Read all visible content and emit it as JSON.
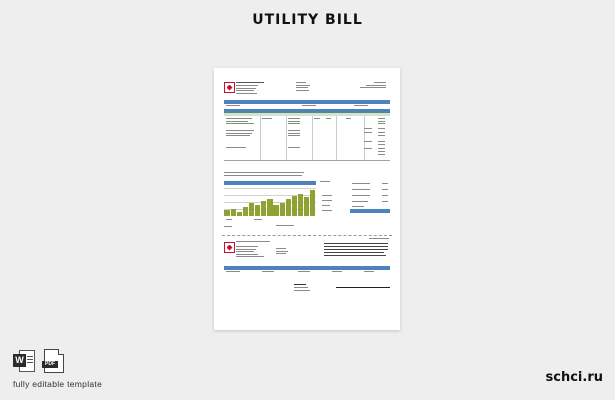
{
  "header": {
    "title": "UTILITY BILL"
  },
  "footer": {
    "template_note": "fully editable template",
    "site": "schci.ru",
    "word_icon_letter": "W",
    "pdf_icon_label": "PDF"
  },
  "colors": {
    "accent_blue": "#4f81bd",
    "chart_green": "#8fa335",
    "subheader_green": "#d7e4bd",
    "logo_red": "#c8102e"
  },
  "document": {
    "chart_values": [
      3,
      4,
      2,
      5,
      7,
      6,
      8,
      9,
      6,
      7,
      9,
      11,
      12,
      10,
      14
    ]
  }
}
